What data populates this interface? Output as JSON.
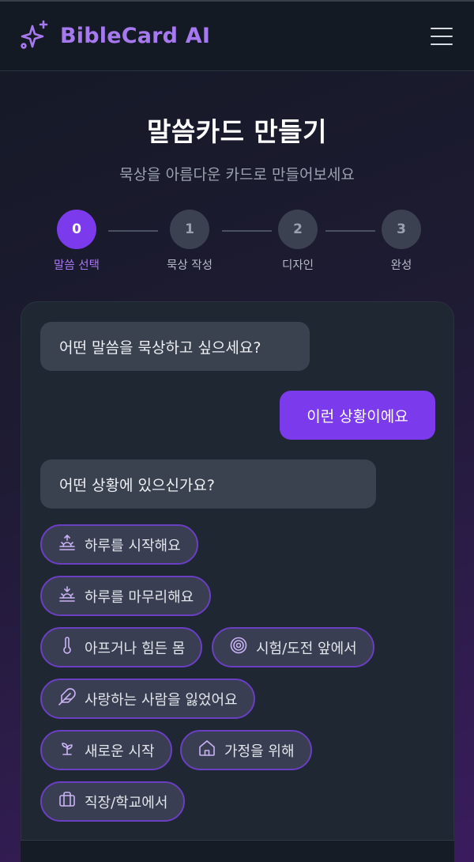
{
  "header": {
    "brand_name": "BibleCard AI",
    "logo_icon": "sparkles-icon",
    "menu_icon": "hamburger-menu-icon",
    "accent_color": "#a779f0"
  },
  "hero": {
    "title": "말씀카드 만들기",
    "subtitle": "묵상을 아름다운 카드로 만들어보세요"
  },
  "stepper": {
    "steps": [
      {
        "number": "0",
        "label": "말씀 선택",
        "active": true
      },
      {
        "number": "1",
        "label": "묵상 작성",
        "active": false
      },
      {
        "number": "2",
        "label": "디자인",
        "active": false
      },
      {
        "number": "3",
        "label": "완성",
        "active": false
      }
    ],
    "active_color": "#7c3aed"
  },
  "chat": {
    "messages": [
      {
        "role": "bot",
        "text": "어떤 말씀을 묵상하고 싶으세요?"
      },
      {
        "role": "user",
        "text": "이런 상황이에요"
      },
      {
        "role": "bot",
        "text": "어떤 상황에 있으신가요?"
      }
    ],
    "options": [
      {
        "label": "하루를 시작해요",
        "icon": "sunrise-icon"
      },
      {
        "label": "하루를 마무리해요",
        "icon": "sunset-icon"
      },
      {
        "label": "아프거나 힘든 몸",
        "icon": "thermometer-icon"
      },
      {
        "label": "시험/도전 앞에서",
        "icon": "target-icon"
      },
      {
        "label": "사랑하는 사람을 잃었어요",
        "icon": "feather-icon"
      },
      {
        "label": "새로운 시작",
        "icon": "sprout-icon"
      },
      {
        "label": "가정을 위해",
        "icon": "home-icon"
      },
      {
        "label": "직장/학교에서",
        "icon": "briefcase-icon"
      }
    ]
  }
}
